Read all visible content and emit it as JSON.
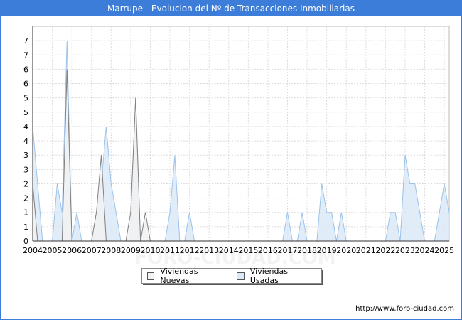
{
  "page": {
    "title": "Marrupe - Evolucion del Nº de Transacciones Inmobiliarias",
    "source": "http://www.foro-ciudad.com",
    "watermark": "FORO-CIUDAD.COM"
  },
  "chart_data": {
    "type": "area",
    "title": "Marrupe - Evolucion del Nº de Transacciones Inmobiliarias",
    "xlabel": "",
    "ylabel": "",
    "x_tick_labels": [
      "2004",
      "2005",
      "2006",
      "2007",
      "2008",
      "2009",
      "2010",
      "2011",
      "2012",
      "2013",
      "2014",
      "2015",
      "2016",
      "2017",
      "2018",
      "2019",
      "2020",
      "2021",
      "2022",
      "2023",
      "2024",
      "2025"
    ],
    "y_tick_labels": [
      "0",
      "1",
      "1",
      "2",
      "2",
      "3",
      "3",
      "4",
      "4",
      "5",
      "5",
      "6",
      "6",
      "7",
      "7"
    ],
    "ylim": [
      0,
      7.5
    ],
    "grid": true,
    "legend_position": "bottom-center",
    "colors": {
      "nuevas_fill": "#f2f2f2",
      "nuevas_line": "#808080",
      "usadas_fill": "#dce9f8",
      "usadas_line": "#9cc3ea",
      "grid": "#dddddd",
      "axis": "#333333"
    },
    "quarters": [
      "2004Q1",
      "2004Q2",
      "2004Q3",
      "2004Q4",
      "2005Q1",
      "2005Q2",
      "2005Q3",
      "2005Q4",
      "2006Q1",
      "2006Q2",
      "2006Q3",
      "2006Q4",
      "2007Q1",
      "2007Q2",
      "2007Q3",
      "2007Q4",
      "2008Q1",
      "2008Q2",
      "2008Q3",
      "2008Q4",
      "2009Q1",
      "2009Q2",
      "2009Q3",
      "2009Q4",
      "2010Q1",
      "2010Q2",
      "2010Q3",
      "2010Q4",
      "2011Q1",
      "2011Q2",
      "2011Q3",
      "2011Q4",
      "2012Q1",
      "2012Q2",
      "2012Q3",
      "2012Q4",
      "2013Q1",
      "2013Q2",
      "2013Q3",
      "2013Q4",
      "2014Q1",
      "2014Q2",
      "2014Q3",
      "2014Q4",
      "2015Q1",
      "2015Q2",
      "2015Q3",
      "2015Q4",
      "2016Q1",
      "2016Q2",
      "2016Q3",
      "2016Q4",
      "2017Q1",
      "2017Q2",
      "2017Q3",
      "2017Q4",
      "2018Q1",
      "2018Q2",
      "2018Q3",
      "2018Q4",
      "2019Q1",
      "2019Q2",
      "2019Q3",
      "2019Q4",
      "2020Q1",
      "2020Q2",
      "2020Q3",
      "2020Q4",
      "2021Q1",
      "2021Q2",
      "2021Q3",
      "2021Q4",
      "2022Q1",
      "2022Q2",
      "2022Q3",
      "2022Q4",
      "2023Q1",
      "2023Q2",
      "2023Q3",
      "2023Q4",
      "2024Q1",
      "2024Q2",
      "2024Q3",
      "2024Q4",
      "2025Q1",
      "2025Q2"
    ],
    "series": [
      {
        "name": "Viviendas Nuevas",
        "values": [
          2,
          0,
          0,
          0,
          0,
          0,
          0,
          6,
          0,
          0,
          0,
          0,
          0,
          1,
          3,
          0,
          0,
          0,
          0,
          0,
          1,
          5,
          0,
          1,
          0,
          0,
          0,
          0,
          0,
          0,
          0,
          0,
          0,
          0,
          0,
          0,
          0,
          0,
          0,
          0,
          0,
          0,
          0,
          0,
          0,
          0,
          0,
          0,
          0,
          0,
          0,
          0,
          0,
          0,
          0,
          0,
          0,
          0,
          0,
          0,
          0,
          0,
          0,
          0,
          0,
          0,
          0,
          0,
          0,
          0,
          0,
          0,
          0,
          0,
          0,
          0,
          0,
          0,
          0,
          0,
          0,
          0,
          0,
          0,
          0,
          0
        ]
      },
      {
        "name": "Viviendas Usadas",
        "values": [
          4,
          2,
          0,
          0,
          0,
          2,
          1,
          7,
          0,
          1,
          0,
          0,
          0,
          1,
          2,
          4,
          2,
          1,
          0,
          0,
          0,
          5,
          0,
          0,
          0,
          0,
          0,
          0,
          1,
          3,
          0,
          0,
          1,
          0,
          0,
          0,
          0,
          0,
          0,
          0,
          0,
          0,
          0,
          0,
          0,
          0,
          0,
          0,
          0,
          0,
          0,
          0,
          1,
          0,
          0,
          1,
          0,
          0,
          0,
          2,
          1,
          1,
          0,
          1,
          0,
          0,
          0,
          0,
          0,
          0,
          0,
          0,
          0,
          1,
          1,
          0,
          3,
          2,
          2,
          1,
          0,
          0,
          0,
          1,
          2,
          1
        ]
      }
    ]
  }
}
